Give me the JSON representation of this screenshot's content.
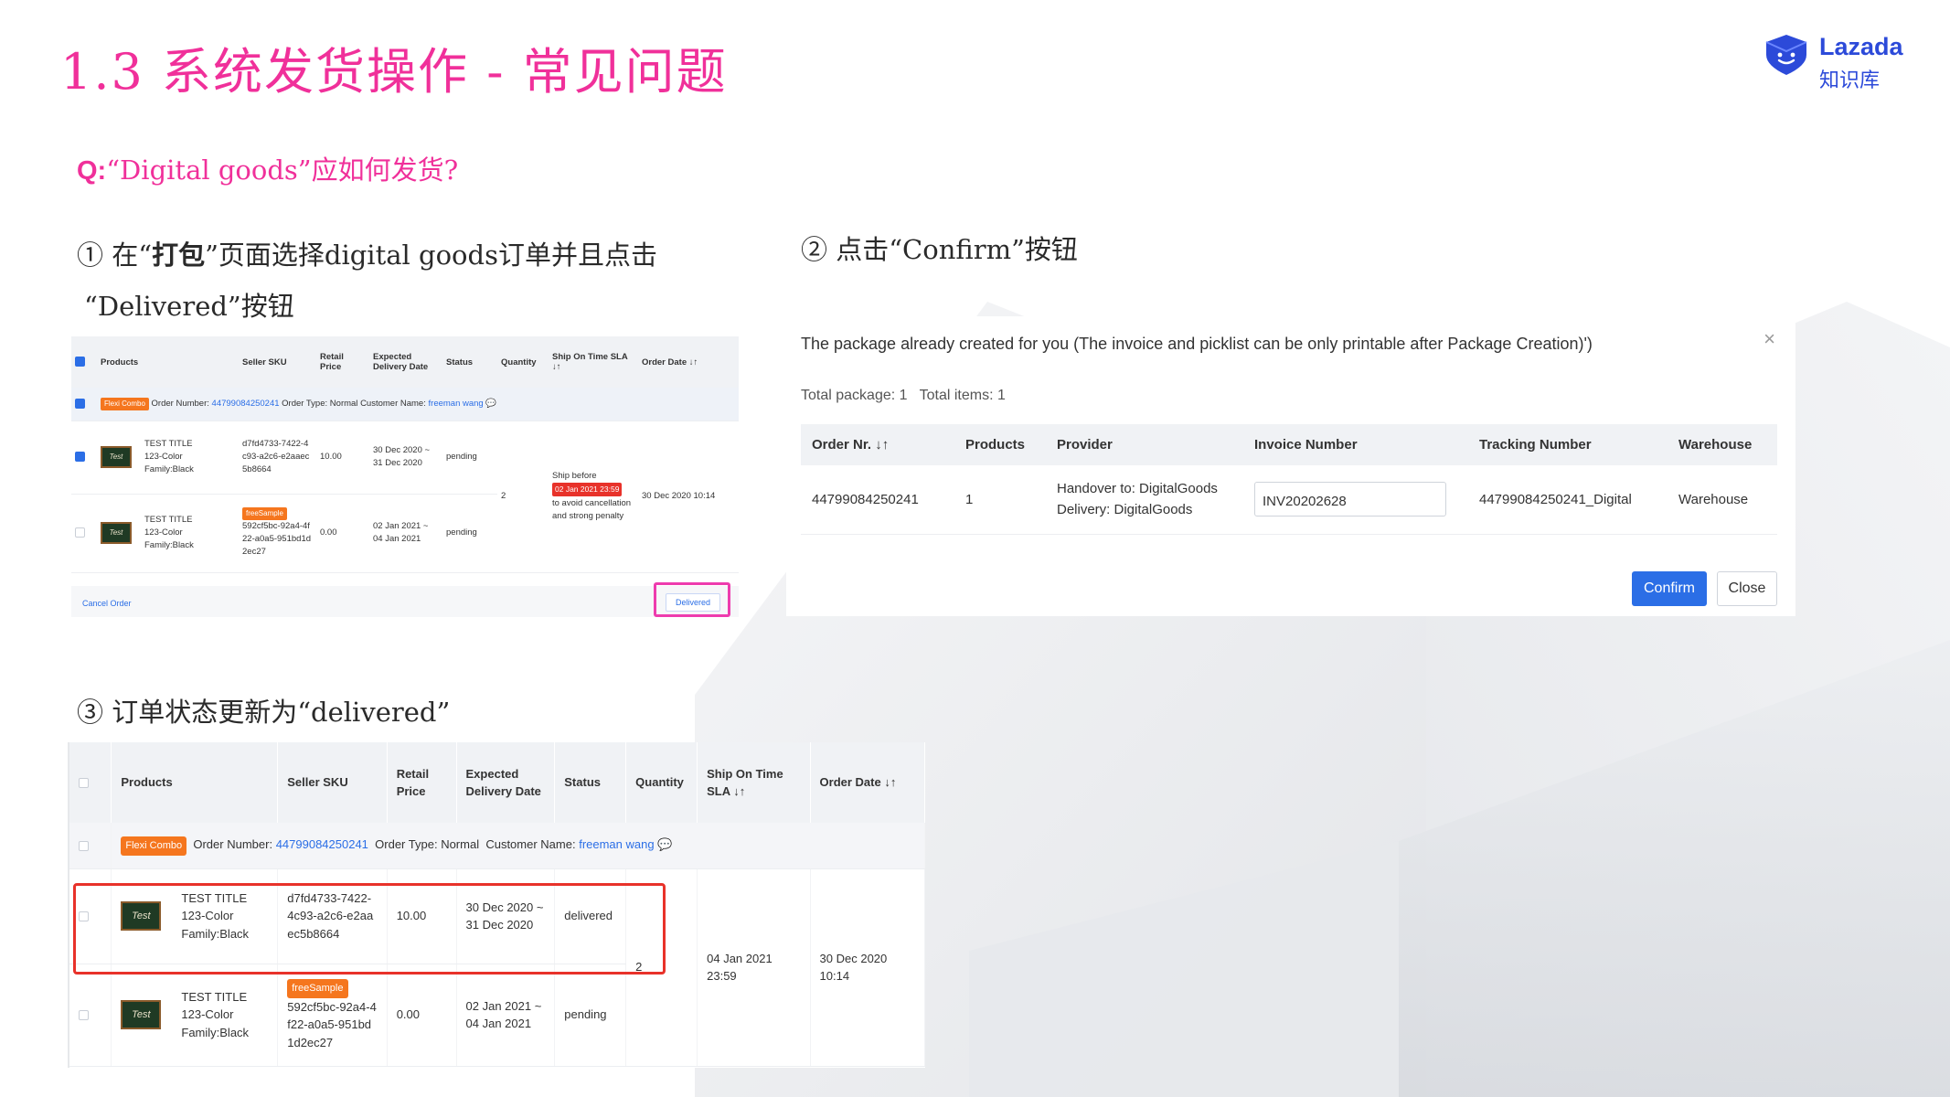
{
  "slide": {
    "title": "1.3 系统发货操作 - 常见问题",
    "question_prefix": "Q:",
    "question_text": "“Digital goods”应如何发货?",
    "accent_color": "#f0309a"
  },
  "logo": {
    "name": "Lazada",
    "subtitle": "知识库",
    "icon": "lazada-heart-icon"
  },
  "steps": [
    {
      "num": "①",
      "pre": "在“",
      "bold": "打包",
      "post": "”页面选择digital goods订单并且点击",
      "line2": "“Delivered”按钮"
    },
    {
      "num": "②",
      "text": "点击“Confirm”按钮"
    },
    {
      "num": "③",
      "text": "订单状态更新为“delivered”"
    }
  ],
  "panel1": {
    "headers": [
      "Products",
      "Seller SKU",
      "Retail Price",
      "Expected Delivery Date",
      "Status",
      "Quantity",
      "Ship On Time SLA ↓↑",
      "Order Date ↓↑"
    ],
    "group": {
      "tag": "Flexi Combo",
      "order_label": "Order Number:",
      "order_number": "44799084250241",
      "type_label": "Order Type:",
      "type_value": "Normal",
      "customer_label": "Customer Name:",
      "customer_value": "freeman wang"
    },
    "rows": [
      {
        "product": "TEST TITLE 123-Color Family:Black",
        "tag": "",
        "sku": "d7fd4733-7422-4c93-a2c6-e2aaec5b8664",
        "price": "10.00",
        "delivery": "30 Dec 2020 ~ 31 Dec 2020",
        "status": "pending"
      },
      {
        "product": "TEST TITLE 123-Color Family:Black",
        "tag": "freeSample",
        "sku": "592cf5bc-92a4-4f22-a0a5-951bd1d2ec27",
        "price": "0.00",
        "delivery": "02 Jan 2021 ~ 04 Jan 2021",
        "status": "pending"
      }
    ],
    "quantity": "2",
    "sla_pre": "Ship before",
    "sla_deadline": "02 Jan 2021 23:59",
    "sla_post": "to avoid cancellation and strong penalty",
    "order_date": "30 Dec 2020 10:14",
    "thumb_label": "Test",
    "cancel_label": "Cancel Order",
    "delivered_label": "Delivered"
  },
  "panel2": {
    "title": "The package already created for you (The invoice and picklist can be only printable after Package Creation)')",
    "close_icon": "×",
    "total_package_label": "Total package:",
    "total_package": "1",
    "total_items_label": "Total items:",
    "total_items": "1",
    "headers": [
      "Order Nr. ↓↑",
      "Products",
      "Provider",
      "Invoice Number",
      "Tracking Number",
      "Warehouse"
    ],
    "row": {
      "order": "44799084250241",
      "products": "1",
      "provider_handover": "Handover to: DigitalGoods",
      "provider_delivery": "Delivery: DigitalGoods",
      "invoice": "INV20202628",
      "tracking": "44799084250241_Digital",
      "warehouse": "Warehouse"
    },
    "confirm_label": "Confirm",
    "close_label": "Close"
  },
  "panel3": {
    "headers": [
      "Products",
      "Seller SKU",
      "Retail Price",
      "Expected Delivery Date",
      "Status",
      "Quantity",
      "Ship On Time SLA ↓↑",
      "Order Date ↓↑"
    ],
    "group": {
      "tag": "Flexi Combo",
      "order_label": "Order Number:",
      "order_number": "44799084250241",
      "type_label": "Order Type:",
      "type_value": "Normal",
      "customer_label": "Customer Name:",
      "customer_value": "freeman wang"
    },
    "rows": [
      {
        "product": "TEST TITLE 123-Color Family:Black",
        "tag": "",
        "sku": "d7fd4733-7422-4c93-a2c6-e2aaec5b8664",
        "price": "10.00",
        "delivery": "30 Dec 2020 ~ 31 Dec 2020",
        "status": "delivered"
      },
      {
        "product": "TEST TITLE 123-Color Family:Black",
        "tag": "freeSample",
        "sku": "592cf5bc-92a4-4f22-a0a5-951bd1d2ec27",
        "price": "0.00",
        "delivery": "02 Jan 2021 ~ 04 Jan 2021",
        "status": "pending"
      }
    ],
    "quantity": "2",
    "sla": "04 Jan 2021 23:59",
    "order_date": "30 Dec 2020 10:14",
    "thumb_label": "Test"
  }
}
